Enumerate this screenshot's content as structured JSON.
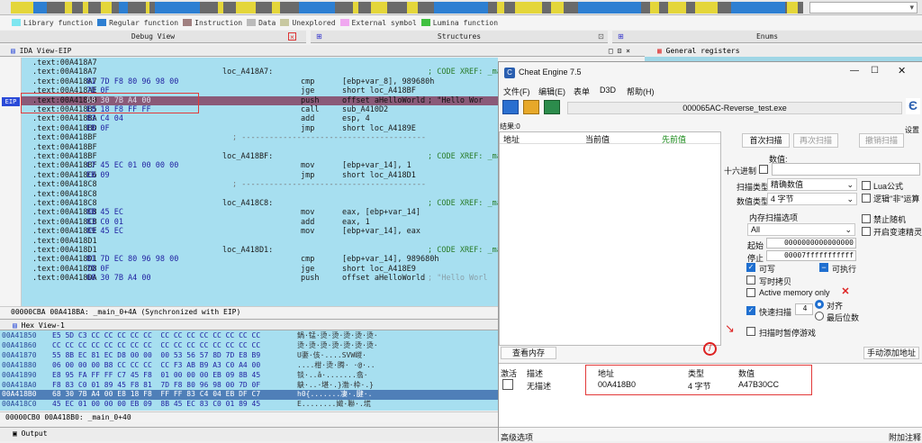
{
  "ida": {
    "legend": [
      "Library function",
      "Regular function",
      "Instruction",
      "Data",
      "Unexplored",
      "External symbol",
      "Lumina function"
    ],
    "legend_colors": [
      "#7ee6f0",
      "#2d7fd2",
      "#a08080",
      "#bbbbbb",
      "#c8c8a0",
      "#f0a8f0",
      "#40c040"
    ],
    "tabs": {
      "debug_view": "Debug View",
      "structures": "Structures",
      "enums": "Enums"
    },
    "ida_view_title": "IDA View-EIP",
    "general_registers": "General registers",
    "eip_label": "EIP",
    "asm_lines": [
      {
        "addr": ".text:00A418A7",
        "bytes": "",
        "label": "",
        "mnem": "",
        "ops": "",
        "comment": ""
      },
      {
        "addr": ".text:00A418A7",
        "bytes": "",
        "label": "loc_A418A7:",
        "mnem": "",
        "ops": "",
        "comment": "; CODE XREF: _ma"
      },
      {
        "addr": ".text:00A418A7",
        "bytes": "81 7D F8 80 96 98 00",
        "label": "",
        "mnem": "cmp",
        "ops": "[ebp+var_8], 989680h",
        "comment": ""
      },
      {
        "addr": ".text:00A418AE",
        "bytes": "7D 0F",
        "label": "",
        "mnem": "jge",
        "ops": "short loc_A418BF",
        "comment": ""
      },
      {
        "addr": ".text:00A418B0",
        "bytes": "68 30 7B A4 00",
        "label": "",
        "mnem": "push",
        "ops": "offset aHelloWorld",
        "comment": "; \"Hello Wor"
      },
      {
        "addr": ".text:00A418B5",
        "bytes": "E8 18 F8 FF FF",
        "label": "",
        "mnem": "call",
        "ops": "sub_A410D2",
        "comment": ""
      },
      {
        "addr": ".text:00A418BA",
        "bytes": "83 C4 04",
        "label": "",
        "mnem": "add",
        "ops": "esp, 4",
        "comment": ""
      },
      {
        "addr": ".text:00A418BD",
        "bytes": "EB 0F",
        "label": "",
        "mnem": "jmp",
        "ops": "short loc_A4189E",
        "comment": ""
      },
      {
        "addr": ".text:00A418BF",
        "bytes": "",
        "label": "",
        "mnem": "",
        "ops": "",
        "comment": "; ----------------------------------------"
      },
      {
        "addr": ".text:00A418BF",
        "bytes": "",
        "label": "",
        "mnem": "",
        "ops": "",
        "comment": ""
      },
      {
        "addr": ".text:00A418BF",
        "bytes": "",
        "label": "loc_A418BF:",
        "mnem": "",
        "ops": "",
        "comment": "; CODE XREF: _ma"
      },
      {
        "addr": ".text:00A418BF",
        "bytes": "C7 45 EC 01 00 00 00",
        "label": "",
        "mnem": "mov",
        "ops": "[ebp+var_14], 1",
        "comment": ""
      },
      {
        "addr": ".text:00A418C6",
        "bytes": "EB 09",
        "label": "",
        "mnem": "jmp",
        "ops": "short loc_A418D1",
        "comment": ""
      },
      {
        "addr": ".text:00A418C8",
        "bytes": "",
        "label": "",
        "mnem": "",
        "ops": "",
        "comment": "; ----------------------------------------"
      },
      {
        "addr": ".text:00A418C8",
        "bytes": "",
        "label": "",
        "mnem": "",
        "ops": "",
        "comment": ""
      },
      {
        "addr": ".text:00A418C8",
        "bytes": "",
        "label": "loc_A418C8:",
        "mnem": "",
        "ops": "",
        "comment": "; CODE XREF: _ma"
      },
      {
        "addr": ".text:00A418C8",
        "bytes": "8B 45 EC",
        "label": "",
        "mnem": "mov",
        "ops": "eax, [ebp+var_14]",
        "comment": ""
      },
      {
        "addr": ".text:00A418CB",
        "bytes": "83 C0 01",
        "label": "",
        "mnem": "add",
        "ops": "eax, 1",
        "comment": ""
      },
      {
        "addr": ".text:00A418CE",
        "bytes": "89 45 EC",
        "label": "",
        "mnem": "mov",
        "ops": "[ebp+var_14], eax",
        "comment": ""
      },
      {
        "addr": ".text:00A418D1",
        "bytes": "",
        "label": "",
        "mnem": "",
        "ops": "",
        "comment": ""
      },
      {
        "addr": ".text:00A418D1",
        "bytes": "",
        "label": "loc_A418D1:",
        "mnem": "",
        "ops": "",
        "comment": "; CODE XREF: _ma"
      },
      {
        "addr": ".text:00A418D1",
        "bytes": "81 7D EC 80 96 98 00",
        "label": "",
        "mnem": "cmp",
        "ops": "[ebp+var_14], 989680h",
        "comment": ""
      },
      {
        "addr": ".text:00A418D8",
        "bytes": "7D 0F",
        "label": "",
        "mnem": "jge",
        "ops": "short loc_A418E9",
        "comment": ""
      },
      {
        "addr": ".text:00A418DA",
        "bytes": "68 30 7B A4 00",
        "label": "",
        "mnem": "push",
        "ops": "offset aHelloWorld",
        "comment": "; \"Hello Worl"
      }
    ],
    "asm_status": "00000CBA 00A418BA: _main_0+4A (Synchronized with EIP)",
    "hex_title": "Hex View-1",
    "hex_lines": [
      {
        "addr": "00A41850",
        "bytes": "E5 5D C3 CC CC CC CC CC  CC CC CC CC CC CC CC CC",
        "ascii": "鍋·锰·烫·烫·烫·烫·烫·"
      },
      {
        "addr": "00A41860",
        "bytes": "CC CC CC CC CC CC CC CC  CC CC CC CC CC CC CC CC",
        "ascii": "烫·烫·烫·烫·烫·烫·烫·"
      },
      {
        "addr": "00A41870",
        "bytes": "55 8B EC 81 EC D8 00 00  00 53 56 57 8D 7D E8 B9",
        "ascii": "U嬱·侅·....SVW嵕·"
      },
      {
        "addr": "00A41880",
        "bytes": "06 00 00 00 B8 CC CC CC  CC F3 AB B9 A3 C0 A4 00",
        "ascii": "....柑·烫·腾· ·@·.."
      },
      {
        "addr": "00A41890",
        "b-tes": "",
        "bytes": "E8 95 FA FF FF C7 45 F8  01 00 00 00 EB 09 8B 45",
        "ascii": "锬·..ǎ·.......翕·"
      },
      {
        "addr": "00A418A0",
        "bytes": "F8 83 C0 01 89 45 F8 81  7D F8 80 96 98 00 7D 0F",
        "ascii": "鴃·..·堪·.}渤·枠·.}"
      },
      {
        "addr": "00A418B0",
        "bytes": "68 30 7B A4 00 E8 18 F8  FF FF 83 C4 04 EB DF C7",
        "ascii": "h0{.......凄·.腱·."
      },
      {
        "addr": "00A418C0",
        "bytes": "45 EC 01 00 00 00 EB 09  8B 45 EC 83 C0 01 89 45",
        "ascii": "E........嬍·聯·.塃"
      }
    ],
    "hex_status": "00000CB0 00A418B0: _main_0+40",
    "output_title": "Output"
  },
  "ce": {
    "window_title": "Cheat Engine 7.5",
    "menu": [
      "文件(F)",
      "编辑(E)",
      "表单",
      "D3D",
      "帮助(H)"
    ],
    "process": "000065AC-Reverse_test.exe",
    "results": "结果:0",
    "columns": {
      "address": "地址",
      "current": "当前值",
      "previous": "先前值"
    },
    "first_scan": "首次扫描",
    "next_scan": "再次扫描",
    "undo_scan": "撤销扫描",
    "value_label": "数值:",
    "hex_label": "十六进制",
    "scan_type_label": "扫描类型",
    "scan_type_value": "精确数值",
    "value_type_label": "数值类型",
    "value_type_value": "4 字节",
    "lua_formula": "Lua公式",
    "not_op": "逻辑\"非\"运算",
    "disable_random": "禁止随机",
    "speedhack": "开启变速精灵",
    "mem_options": "内存扫描选项",
    "mem_all": "All",
    "start_label": "起始",
    "start_value": "0000000000000000",
    "stop_label": "停止",
    "stop_value": "00007fffffffffff",
    "writable": "可写",
    "executable": "可执行",
    "copy_on_write": "写时拷贝",
    "active_memory": "Active memory only",
    "fast_scan": "快速扫描",
    "fast_scan_value": "4",
    "align": "对齐",
    "last_digits": "最后位数",
    "pause_scan": "扫描时暂停游戏",
    "settings": "设置",
    "view_memory": "查看内存",
    "add_address": "手动添加地址",
    "table_headers": {
      "active": "激活",
      "desc": "描述",
      "address": "地址",
      "type": "类型",
      "value": "数值"
    },
    "table_row": {
      "desc": "无描述",
      "address": "00A418B0",
      "type": "4 字节",
      "value": "A47B30CC"
    },
    "advanced": "高级选项",
    "attach": "附加注释"
  }
}
